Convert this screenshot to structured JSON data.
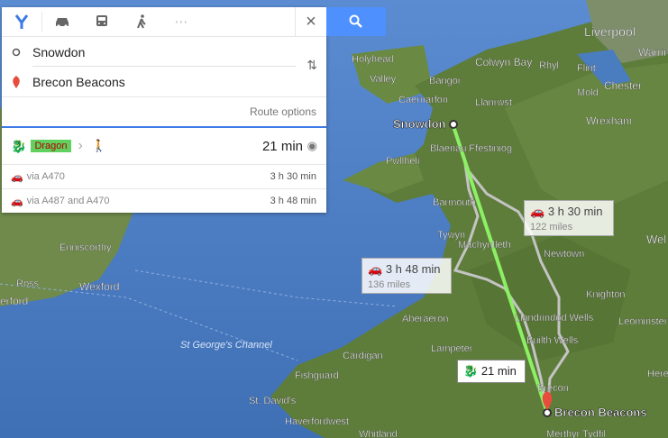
{
  "search": {
    "modes": [
      "directions-icon",
      "car-icon",
      "transit-icon",
      "walk-icon",
      "more-icon"
    ]
  },
  "waypoints": {
    "origin": "Snowdon",
    "destination": "Brecon Beacons"
  },
  "route_options_label": "Route options",
  "routes": {
    "main": {
      "badge": "Dragon",
      "time": "21 min"
    },
    "alt1": {
      "via": "via A470",
      "time": "3 h 30 min"
    },
    "alt2": {
      "via": "via A487 and A470",
      "time": "3 h 48 min"
    }
  },
  "map_bubbles": {
    "b1": {
      "time": "3 h 30 min",
      "miles": "122 miles"
    },
    "b2": {
      "time": "3 h 48 min",
      "miles": "136 miles"
    },
    "b3": {
      "time": "21 min"
    }
  },
  "map_labels": {
    "origin": "Snowdon",
    "destination": "Brecon Beacons",
    "liverpool": "Liverpool",
    "wrexham": "Wrexham",
    "chester": "Chester",
    "flint": "Flint",
    "mold": "Mold",
    "rhyl": "Rhyl",
    "colwyn": "Colwyn Bay",
    "bangor": "Bangor",
    "llanrwst": "Llanrwst",
    "holyhead": "Holyhead",
    "valley": "Valley",
    "caernarfon": "Caernarfon",
    "blaenau": "Blaenau Ffestiniog",
    "pwllheli": "Pwllheli",
    "barmouth": "Barmouth",
    "tywyn": "Tywyn",
    "machynlleth": "Machynlleth",
    "newtown": "Newtown",
    "welshpool": "Wel",
    "knighton": "Knighton",
    "llandrindod": "Llandrindod Wells",
    "leominster": "Leominster",
    "aberaeron": "Aberaeron",
    "builth": "Builth Wells",
    "lampeter": "Lampeter",
    "cardigan": "Cardigan",
    "fishguard": "Fishguard",
    "stdavids": "St. David's",
    "haverfordwest": "Haverfordwest",
    "whitland": "Whitland",
    "merthyr": "Merthyr Tydfil",
    "here": "Here",
    "brecon": "Brecon",
    "stgeorges": "St George's Channel",
    "enniscorthy": "Enniscorthy",
    "wexford": "Wexford",
    "ross": "Ross",
    "erford": "erford",
    "arrive": "Warrin"
  },
  "colors": {
    "accent": "#3d7ae5",
    "route": "#8cf064",
    "alt_route": "#b8b8b8",
    "sea": "#4a7cc0",
    "land": "#5b7a3a"
  }
}
